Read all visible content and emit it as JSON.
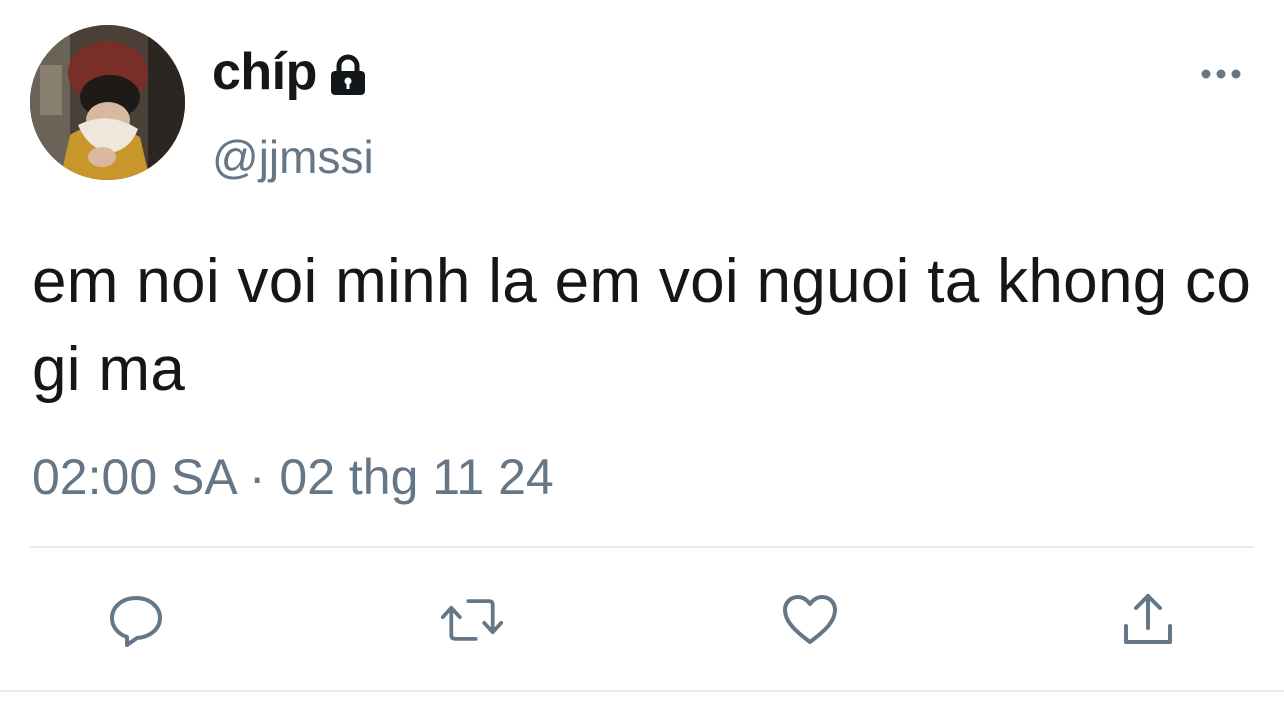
{
  "user": {
    "display_name": "chíp",
    "handle": "@jjmssi",
    "protected": true,
    "lock_icon": "lock-icon",
    "avatar_icon": "avatar"
  },
  "tweet": {
    "text": "em noi voi minh la em voi nguoi ta khong co gi ma",
    "timestamp": "02:00 SA · 02 thg 11 24"
  },
  "actions": [
    {
      "name": "reply",
      "icon": "comment-icon"
    },
    {
      "name": "retweet",
      "icon": "retweet-icon"
    },
    {
      "name": "like",
      "icon": "heart-icon"
    },
    {
      "name": "share",
      "icon": "share-icon"
    }
  ],
  "menu": {
    "icon": "more-options-icon"
  },
  "colors": {
    "text": "#14171a",
    "secondary": "#657786",
    "divider": "#e6ecf0"
  }
}
